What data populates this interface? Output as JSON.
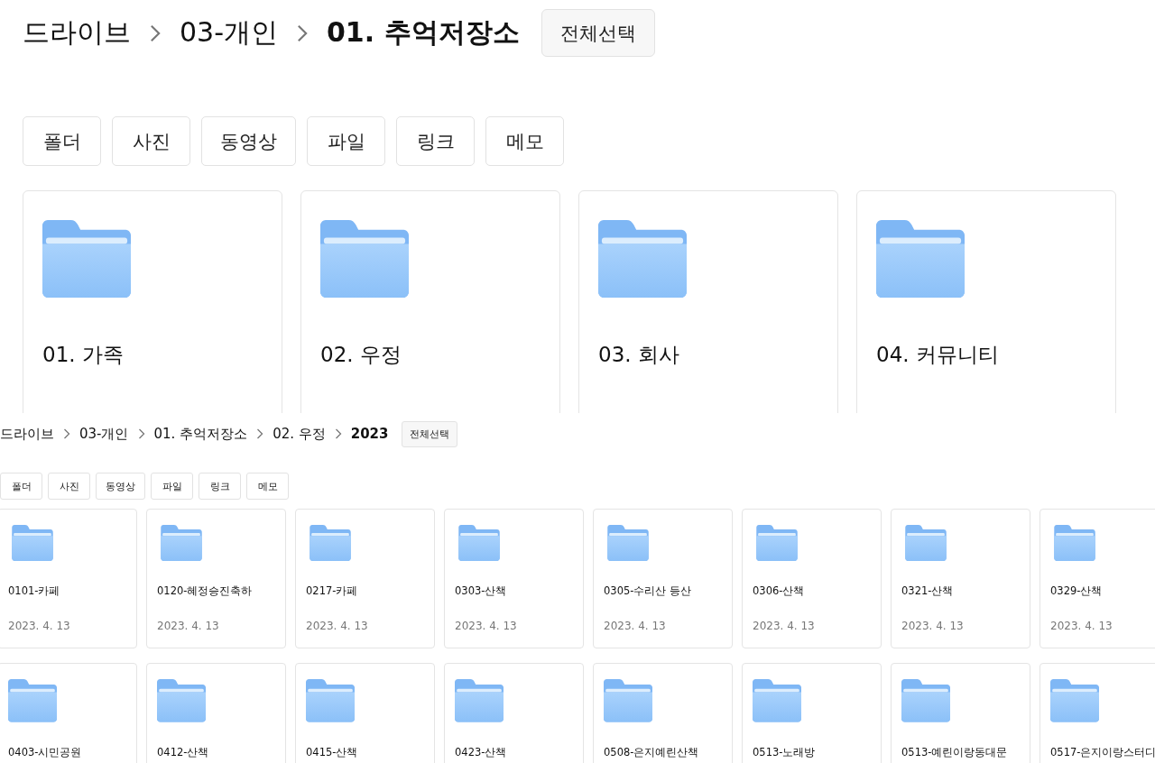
{
  "views": [
    {
      "breadcrumb": [
        "드라이브",
        "03-개인",
        "01. 추억저장소"
      ],
      "select_all": "전체선택",
      "filters": [
        "폴더",
        "사진",
        "동영상",
        "파일",
        "링크",
        "메모"
      ],
      "folders": [
        {
          "name": "01. 가족"
        },
        {
          "name": "02. 우정"
        },
        {
          "name": "03. 회사"
        },
        {
          "name": "04. 커뮤니티"
        }
      ]
    },
    {
      "breadcrumb": [
        "드라이브",
        "03-개인",
        "01. 추억저장소",
        "02. 우정",
        "2023"
      ],
      "select_all": "전체선택",
      "filters": [
        "폴더",
        "사진",
        "동영상",
        "파일",
        "링크",
        "메모"
      ],
      "folders": [
        {
          "name": "0101-카페",
          "date": "2023. 4. 13"
        },
        {
          "name": "0120-혜정승진축하",
          "date": "2023. 4. 13"
        },
        {
          "name": "0217-카페",
          "date": "2023. 4. 13"
        },
        {
          "name": "0303-산책",
          "date": "2023. 4. 13"
        },
        {
          "name": "0305-수리산 등산",
          "date": "2023. 4. 13"
        },
        {
          "name": "0306-산책",
          "date": "2023. 4. 13"
        },
        {
          "name": "0321-산책",
          "date": "2023. 4. 13"
        },
        {
          "name": "0329-산책",
          "date": "2023. 4. 13"
        },
        {
          "name": "0403-시민공원"
        },
        {
          "name": "0412-산책"
        },
        {
          "name": "0415-산책"
        },
        {
          "name": "0423-산책"
        },
        {
          "name": "0508-은지예린산책"
        },
        {
          "name": "0513-노래방"
        },
        {
          "name": "0513-예린이랑동대문"
        },
        {
          "name": "0517-은지이랑스터디"
        }
      ]
    }
  ]
}
